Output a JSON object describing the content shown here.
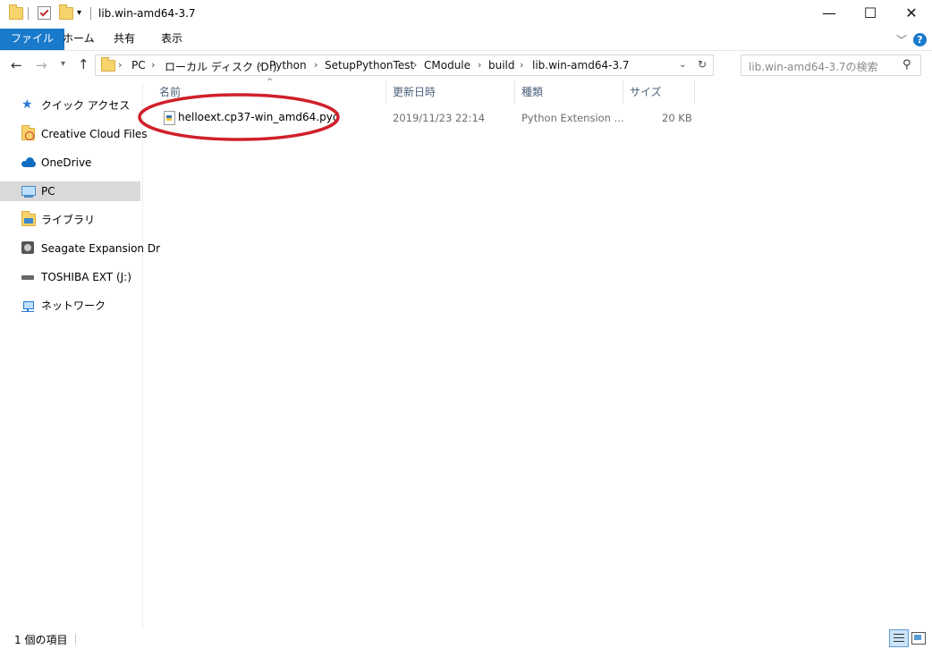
{
  "window": {
    "title": "lib.win-amd64-3.7"
  },
  "ribbon": {
    "tabs": [
      "ファイル",
      "ホーム",
      "共有",
      "表示"
    ]
  },
  "address": {
    "crumbs": [
      "PC",
      "ローカル ディスク (D:)",
      "Python",
      "SetupPythonTest",
      "CModule",
      "build",
      "lib.win-amd64-3.7"
    ]
  },
  "search": {
    "placeholder": "lib.win-amd64-3.7の検索"
  },
  "sidebar": {
    "items": [
      {
        "label": "クイック アクセス",
        "icon": "star-icon"
      },
      {
        "label": "Creative Cloud Files",
        "icon": "creative-cloud-icon"
      },
      {
        "label": "OneDrive",
        "icon": "cloud-icon"
      },
      {
        "label": "PC",
        "icon": "computer-icon"
      },
      {
        "label": "ライブラリ",
        "icon": "library-icon"
      },
      {
        "label": "Seagate Expansion Dr",
        "icon": "drive-icon"
      },
      {
        "label": "TOSHIBA EXT (J:)",
        "icon": "usb-drive-icon"
      },
      {
        "label": "ネットワーク",
        "icon": "network-icon"
      }
    ]
  },
  "columns": {
    "name": "名前",
    "date": "更新日時",
    "type": "種類",
    "size": "サイズ"
  },
  "files": [
    {
      "name": "helloext.cp37-win_amd64.pyd",
      "date": "2019/11/23 22:14",
      "type": "Python Extension ...",
      "size": "20 KB"
    }
  ],
  "status": {
    "count": "1 個の項目"
  },
  "colors": {
    "accent": "#1979ca",
    "highlight_circle": "#d0202a"
  }
}
